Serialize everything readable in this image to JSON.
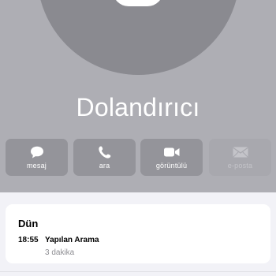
{
  "contact": {
    "name": "Dolandırıcı"
  },
  "actions": [
    {
      "label": "mesaj",
      "icon": "message-bubble-icon",
      "enabled": true
    },
    {
      "label": "ara",
      "icon": "phone-icon",
      "enabled": true
    },
    {
      "label": "görüntülü",
      "icon": "video-camera-icon",
      "enabled": true
    },
    {
      "label": "e-posta",
      "icon": "envelope-icon",
      "enabled": false
    }
  ],
  "history": {
    "day": "Dün",
    "entries": [
      {
        "time": "18:55",
        "type": "Yapılan Arama",
        "duration": "3 dakika"
      }
    ]
  },
  "colors": {
    "header_bg": "#aeaeb4",
    "avatar_bg": "#8a8a90",
    "button_bg": "#94949a",
    "page_bg": "#f2f2f7"
  }
}
